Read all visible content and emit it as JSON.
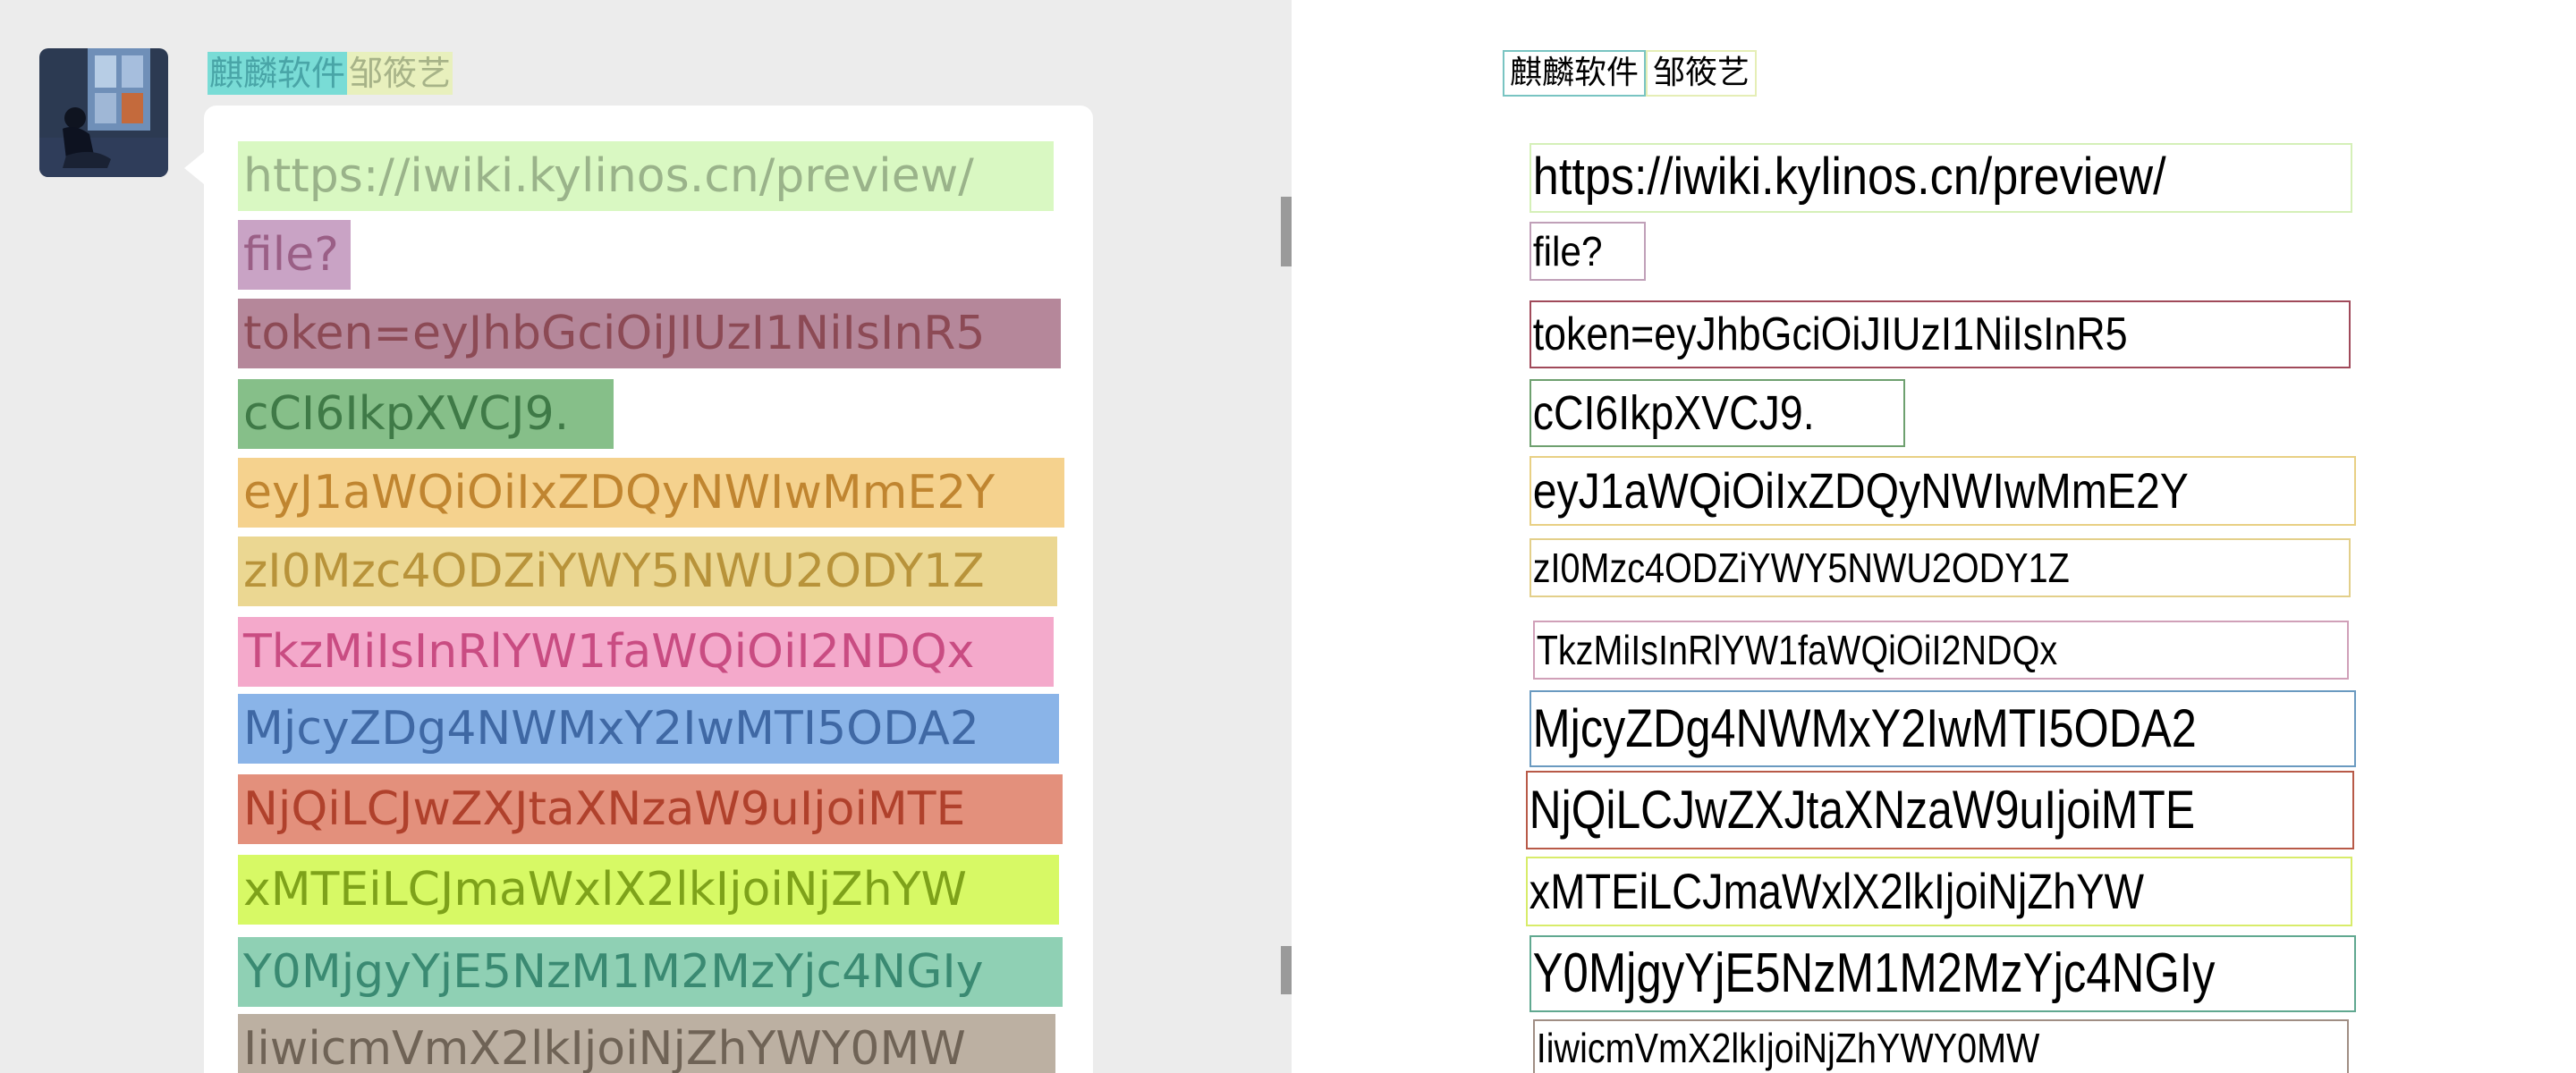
{
  "sender": {
    "company_label": "麒麟软件",
    "name_label": "邹筱艺"
  },
  "message": {
    "lines": [
      "https://iwiki.kylinos.cn/preview/",
      "file?",
      "token=eyJhbGciOiJIUzI1NiIsInR5",
      "cCI6IkpXVCJ9.",
      "eyJ1aWQiOiIxZDQyNWIwMmE2Y",
      "zI0Mzc4ODZiYWY5NWU2ODY1Z",
      "TkzMiIsInRlYW1faWQiOiI2NDQx",
      "MjcyZDg4NWMxY2IwMTI5ODA2",
      "NjQiLCJwZXJtaXNzaW9uIjoiMTE",
      "xMTEiLCJmaWxlX2lkIjoiNjZhYW",
      "Y0MjgyYjE5NzM1M2MzYjc4NGIy",
      "IiwicmVmX2lkIjoiNjZhYWY0MW"
    ]
  },
  "colors": {
    "left_bg": "#ececec",
    "bubble_bg": "#ffffff",
    "line_highlights": [
      "#d9f8c2",
      "#c9a3c5",
      "#b5879a",
      "#86bf89",
      "#f5d28e",
      "#ebd792",
      "#f4a9cb",
      "#8ab4e8",
      "#e3907c",
      "#d7f965",
      "#8fd0b4",
      "#bcb0a2"
    ],
    "line_text": [
      "#9ab38a",
      "#9a5f86",
      "#8c4a55",
      "#3f7a47",
      "#c08530",
      "#b8933a",
      "#c94c82",
      "#3f68a4",
      "#b0412c",
      "#7ea21a",
      "#3a8a72",
      "#6f6356"
    ],
    "right_boxes": [
      "#d5f0b8",
      "#c0a0b8",
      "#a04a5a",
      "#6ea06f",
      "#e8d084",
      "#e3cf8a",
      "#d0a0b8",
      "#6a9ac0",
      "#b85a48",
      "#d8ec6a",
      "#60a890",
      "#a08e84"
    ]
  },
  "icons": {
    "avatar": "avatar-photo"
  }
}
